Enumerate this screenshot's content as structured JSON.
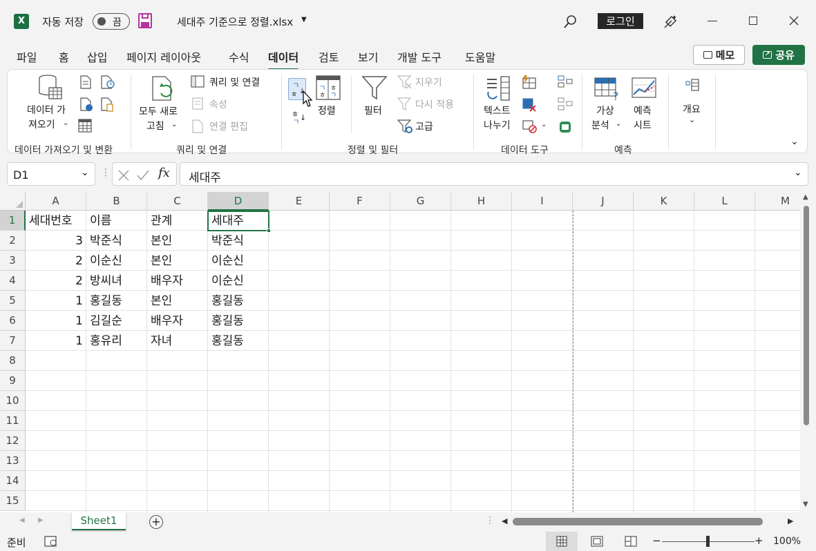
{
  "app": {
    "name": "Excel",
    "logo_letter": "X",
    "accent": "#217346"
  },
  "titlebar": {
    "autosave_label": "자동 저장",
    "autosave_state": "끔",
    "file_name": "세대주 기준으로 정렬.xlsx",
    "login_label": "로그인"
  },
  "tabs": [
    "파일",
    "홈",
    "삽입",
    "페이지 레이아웃",
    "수식",
    "데이터",
    "검토",
    "보기",
    "개발 도구",
    "도움말"
  ],
  "active_tab": "데이터",
  "memo_label": "메모",
  "share_label": "공유",
  "ribbon": {
    "get_data": {
      "line1": "데이터 가",
      "line2": "져오기",
      "group": "데이터 가져오기 및 변환"
    },
    "refresh": {
      "line1": "모두 새로",
      "line2": "고침",
      "group": "쿼리 및 연결"
    },
    "queries_connections": "쿼리 및 연결",
    "properties": "속성",
    "edit_links": "연결 편집",
    "sort": "정렬",
    "sort_az_top": "ㄱ",
    "sort_az_bottom": "ㅎ",
    "filter": "필터",
    "clear": "지우기",
    "reapply": "다시 적용",
    "advanced": "고급",
    "sort_filter_group": "정렬 및 필터",
    "text_to_columns": {
      "line1": "텍스트",
      "line2": "나누기"
    },
    "data_tools_group": "데이터 도구",
    "whatif": {
      "line1": "가상",
      "line2": "분석"
    },
    "forecast": {
      "line1": "예측",
      "line2": "시트"
    },
    "forecast_group": "예측",
    "outline": "개요"
  },
  "formula_bar": {
    "name_box": "D1",
    "fx": "fx",
    "content": "세대주"
  },
  "columns": [
    "A",
    "B",
    "C",
    "D",
    "E",
    "F",
    "G",
    "H",
    "I",
    "J",
    "K",
    "L",
    "M"
  ],
  "rows": [
    "1",
    "2",
    "3",
    "4",
    "5",
    "6",
    "7",
    "8",
    "9",
    "10",
    "11",
    "12",
    "13",
    "14",
    "15"
  ],
  "table": [
    [
      "세대번호",
      "이름",
      "관계",
      "세대주"
    ],
    [
      "3",
      "박준식",
      "본인",
      "박준식"
    ],
    [
      "2",
      "이순신",
      "본인",
      "이순신"
    ],
    [
      "2",
      "방씨녀",
      "배우자",
      "이순신"
    ],
    [
      "1",
      "홍길동",
      "본인",
      "홍길동"
    ],
    [
      "1",
      "김길순",
      "배우자",
      "홍길동"
    ],
    [
      "1",
      "홍유리",
      "자녀",
      "홍길동"
    ]
  ],
  "selected_cell": "D1",
  "sheet_tab": "Sheet1",
  "status": {
    "ready": "준비",
    "zoom": "100%",
    "minus": "−",
    "plus": "+"
  }
}
